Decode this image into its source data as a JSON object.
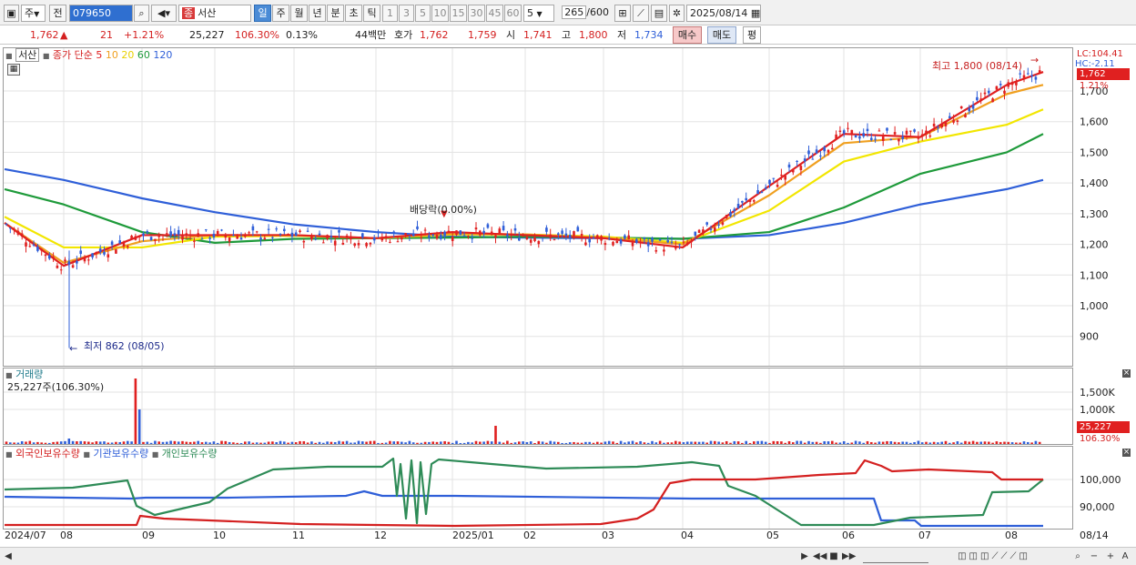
{
  "toolbar": {
    "period_select": "주",
    "prev": "전",
    "code": "079650",
    "name": "서산",
    "name_prefix": "종",
    "periods": [
      "일",
      "주",
      "월",
      "년",
      "분",
      "초",
      "틱"
    ],
    "ticks": [
      "1",
      "3",
      "5",
      "10",
      "15",
      "30",
      "45",
      "60"
    ],
    "interval": "5",
    "count": "265",
    "count_max": "/600",
    "date": "2025/08/14"
  },
  "quote": {
    "price": "1,762",
    "change": "21",
    "change_pct": "+1.21%",
    "volume": "25,227",
    "volume_ratio": "106.30%",
    "turnover": "0.13%",
    "amount": "44백만",
    "bid_label": "호가",
    "ask": "1,762",
    "bid": "1,759",
    "open_label": "시",
    "open": "1,741",
    "high_label": "고",
    "high": "1,800",
    "low_label": "저",
    "low": "1,734",
    "buy": "매수",
    "sell": "매도",
    "avg": "평"
  },
  "price_panel": {
    "name": "서산",
    "indicator_label": "종가 단순",
    "ma_labels": [
      "5",
      "10",
      "20",
      "60",
      "120"
    ],
    "ma_colors": [
      "#e02020",
      "#f0a020",
      "#f2e600",
      "#1e9a3a",
      "#2f5fd8"
    ],
    "lc": "LC:104.41",
    "hc": "HC:-2.11",
    "current_price": "1,762",
    "current_pct": "1.21%",
    "high_note": "최고 1,800 (08/14)",
    "low_note": "최저 862 (08/05)",
    "dividend_note": "배당락(0.00%)"
  },
  "volume_panel": {
    "title": "거래량",
    "value": "25,227주(106.30%)",
    "current": "25,227",
    "current_pct": "106.30%"
  },
  "holdings_panel": {
    "labels": [
      "외국인보유수량",
      "기관보유수량",
      "개인보유수량"
    ],
    "colors": [
      "#d42020",
      "#2f5fd8",
      "#2e8b57"
    ]
  },
  "x_ticks": [
    "2024/07",
    "08",
    "09",
    "10",
    "11",
    "12",
    "2025/01",
    "02",
    "03",
    "04",
    "05",
    "06",
    "07",
    "08",
    "08/14"
  ],
  "chart_data": [
    {
      "type": "line",
      "title": "서산",
      "x": [
        "2024/07",
        "2024/08",
        "2024/09",
        "2024/10",
        "2024/11",
        "2024/12",
        "2025/01",
        "2025/02",
        "2025/03",
        "2025/04",
        "2025/05",
        "2025/06",
        "2025/07",
        "2025/08",
        "08/14"
      ],
      "series": [
        {
          "name": "5",
          "values": [
            1270,
            1130,
            1230,
            1230,
            1230,
            1220,
            1240,
            1230,
            1220,
            1190,
            1390,
            1560,
            1550,
            1720,
            1762
          ]
        },
        {
          "name": "10",
          "values": [
            1270,
            1140,
            1210,
            1230,
            1230,
            1220,
            1235,
            1232,
            1222,
            1200,
            1360,
            1530,
            1550,
            1690,
            1720
          ]
        },
        {
          "name": "20",
          "values": [
            1290,
            1190,
            1190,
            1225,
            1228,
            1220,
            1232,
            1232,
            1225,
            1205,
            1310,
            1470,
            1535,
            1590,
            1640
          ]
        },
        {
          "name": "60",
          "values": [
            1380,
            1330,
            1240,
            1205,
            1218,
            1220,
            1222,
            1225,
            1222,
            1218,
            1240,
            1320,
            1430,
            1500,
            1560
          ]
        },
        {
          "name": "120",
          "values": [
            1445,
            1410,
            1350,
            1305,
            1265,
            1240,
            1225,
            1222,
            1220,
            1218,
            1230,
            1270,
            1330,
            1380,
            1410
          ]
        }
      ],
      "ylim": [
        862,
        1800
      ],
      "yticks": [
        "900",
        "1,000",
        "1,100",
        "1,200",
        "1,300",
        "1,400",
        "1,500",
        "1,600",
        "1,700"
      ]
    },
    {
      "type": "bar",
      "title": "거래량",
      "yticks": [
        "1,000K",
        "1,500K"
      ]
    },
    {
      "type": "line",
      "yticks": [
        "90,000",
        "100,000"
      ]
    }
  ],
  "footer": {
    "zoom": "A"
  }
}
